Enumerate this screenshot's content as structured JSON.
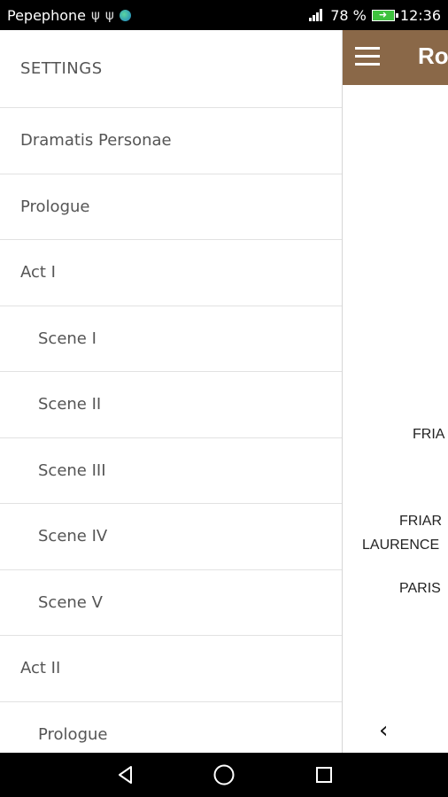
{
  "status_bar": {
    "carrier": "Pepephone",
    "battery_percent": "78 %",
    "time": "12:36"
  },
  "app": {
    "title": "Ro",
    "background_lines": [
      "FRIA",
      "FRIAR",
      "LAURENCE",
      "PARIS"
    ]
  },
  "drawer": {
    "header": "SETTINGS",
    "items": [
      {
        "label": "Dramatis Personae",
        "level": 0
      },
      {
        "label": "Prologue",
        "level": 0
      },
      {
        "label": "Act I",
        "level": 0
      },
      {
        "label": "Scene I",
        "level": 1
      },
      {
        "label": "Scene II",
        "level": 1
      },
      {
        "label": "Scene III",
        "level": 1
      },
      {
        "label": "Scene IV",
        "level": 1
      },
      {
        "label": "Scene V",
        "level": 1
      },
      {
        "label": "Act II",
        "level": 0
      },
      {
        "label": "Prologue",
        "level": 1
      }
    ]
  },
  "colors": {
    "app_bar": "#8a6848",
    "drawer_text": "#555555",
    "divider": "#e2e2e2"
  }
}
